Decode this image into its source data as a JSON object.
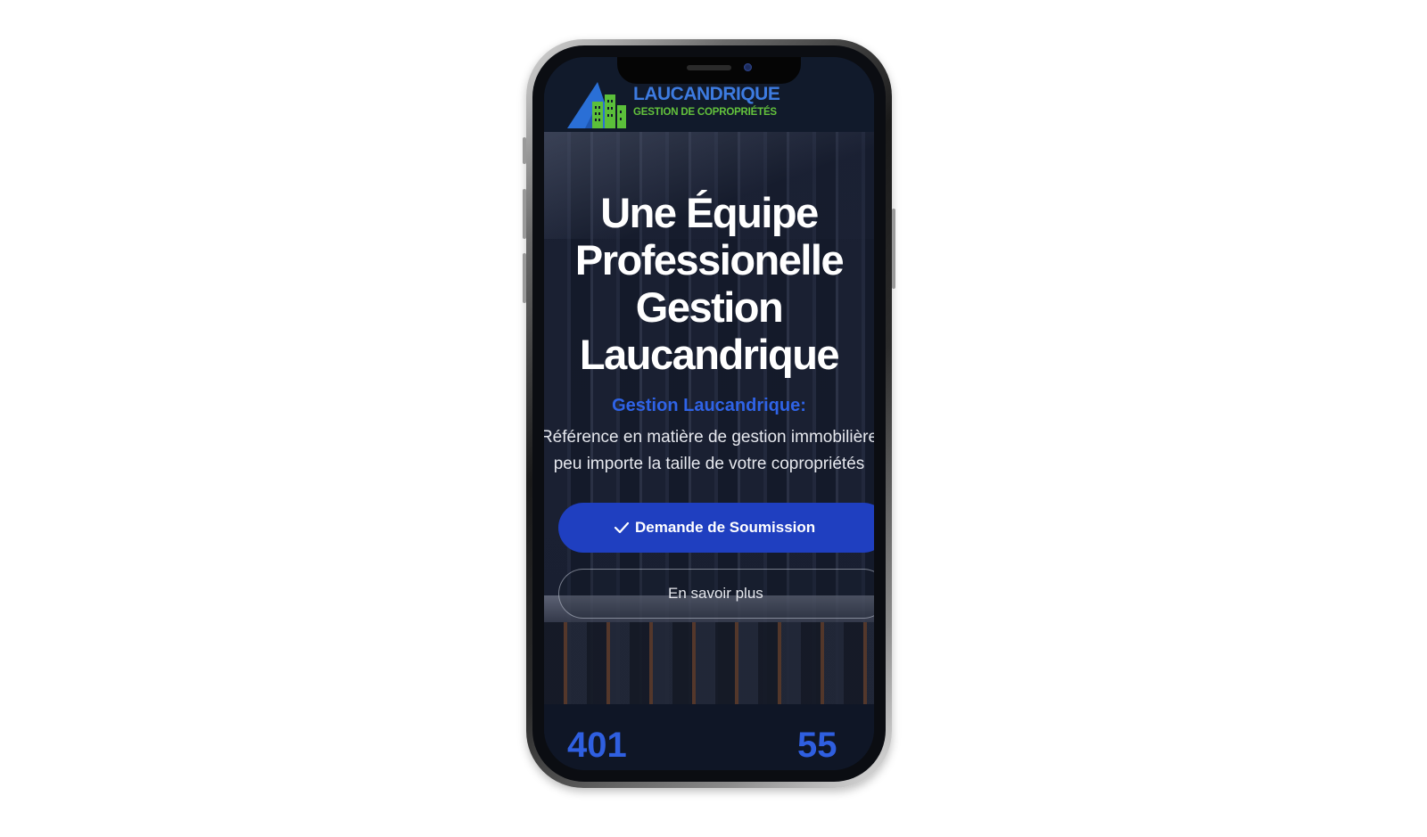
{
  "brand": {
    "name": "LAUCANDRIQUE",
    "tagline": "GESTION DE COPROPRIÉTÉS",
    "colors": {
      "blue": "#3d7be0",
      "green": "#63c23c"
    }
  },
  "hero": {
    "title": "Une Équipe Professionelle Gestion Laucandrique",
    "accent": "Gestion Laucandrique:",
    "subtitle_line1": "Référence en matière de gestion immobilière",
    "subtitle_line2": "peu importe la taille de votre copropriétés",
    "primary_button": "Demande de Soumission",
    "secondary_button": "En savoir plus",
    "accent_color": "#2f63e6",
    "button_color": "#1f3fc0"
  },
  "stats": {
    "left": "401",
    "right": "55"
  },
  "icons": {
    "logo": "building-triangle-logo",
    "primary_button_icon": "check-icon"
  }
}
